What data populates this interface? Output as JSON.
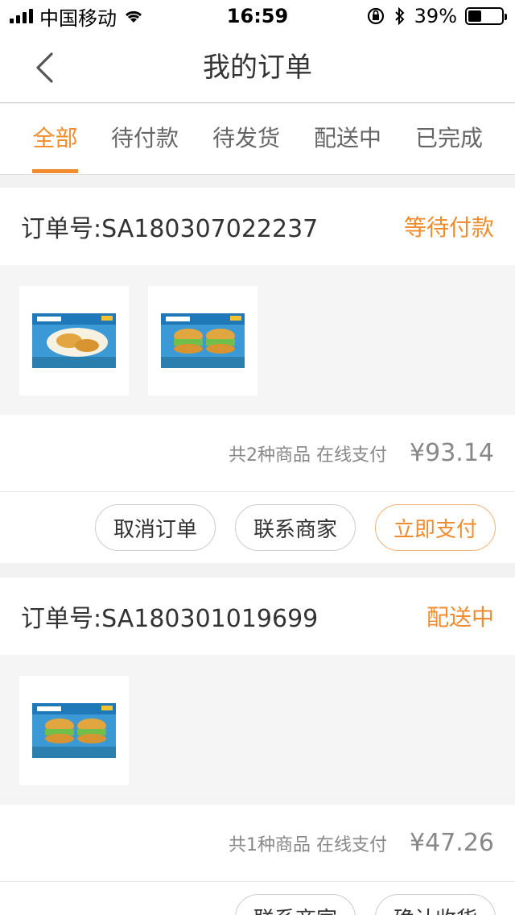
{
  "status_bar": {
    "carrier": "中国移动",
    "time": "16:59",
    "battery": "39%",
    "battery_level": 0.39
  },
  "nav": {
    "title": "我的订单"
  },
  "tabs": [
    {
      "label": "全部",
      "active": true
    },
    {
      "label": "待付款",
      "active": false
    },
    {
      "label": "待发货",
      "active": false
    },
    {
      "label": "配送中",
      "active": false
    },
    {
      "label": "已完成",
      "active": false
    }
  ],
  "orders": [
    {
      "order_no": "订单号:SA180307022237",
      "status": "等待付款",
      "items_text": "共2种商品 在线支付",
      "price": "¥93.14",
      "actions": [
        "取消订单",
        "联系商家",
        "立即支付"
      ]
    },
    {
      "order_no": "订单号:SA180301019699",
      "status": "配送中",
      "items_text": "共1种商品 在线支付",
      "price": "¥47.26",
      "actions": [
        "联系商家",
        "确认收货"
      ]
    }
  ],
  "colors": {
    "accent": "#f08c2e",
    "package_blue": "#2d8fd0"
  }
}
